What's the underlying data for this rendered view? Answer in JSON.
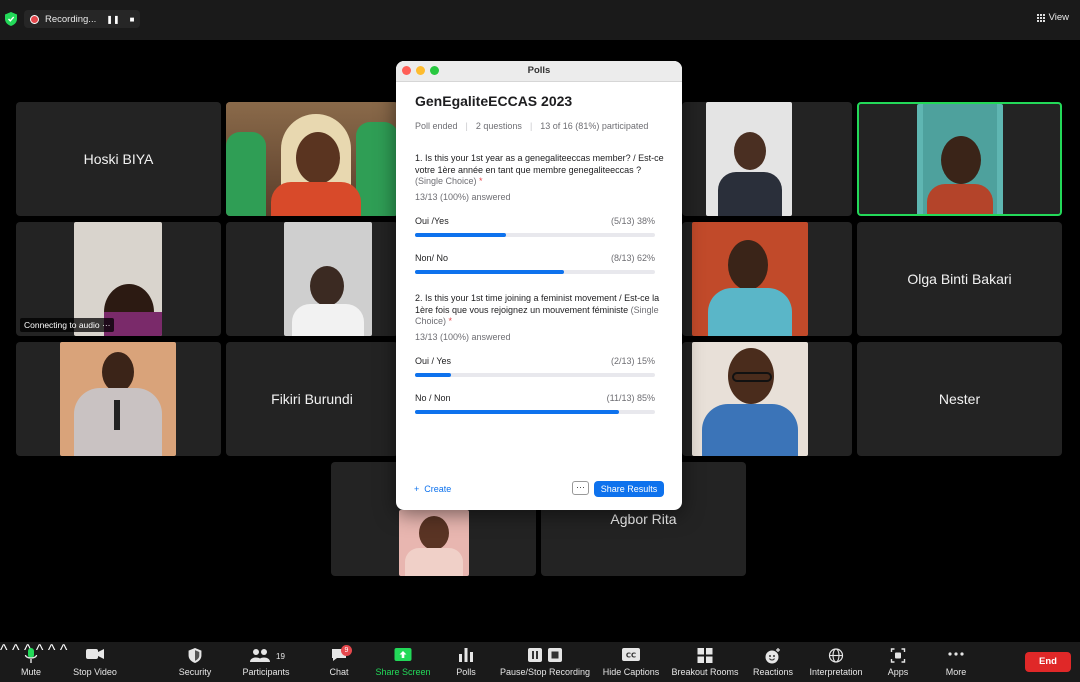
{
  "topbar": {
    "recording_label": "Recording...",
    "view_label": "View"
  },
  "tiles": {
    "hoski": "Hoski BIYA",
    "olga": "Olga Binti Bakari",
    "fikiri": "Fikiri Burundi",
    "nester": "Nester",
    "agbor": "Agbor Rita",
    "connecting": "Connecting to audio"
  },
  "polls": {
    "window_title": "Polls",
    "title": "GenEgaliteECCAS 2023",
    "status": "Poll ended",
    "questions_count": "2 questions",
    "participation": "13 of 16 (81%) participated",
    "questions": [
      {
        "text": "1. Is this your 1st year as a genegaliteeccas member? / Est-ce votre 1ère année en tant que membre genegaliteeccas ?",
        "hint": "(Single Choice)",
        "required": "*",
        "answered": "13/13 (100%) answered",
        "options": [
          {
            "label": "Oui /Yes",
            "result": "(5/13) 38%",
            "fraction": 0.38
          },
          {
            "label": "Non/ No",
            "result": "(8/13) 62%",
            "fraction": 0.62
          }
        ]
      },
      {
        "text": "2. Is this your 1st time joining a feminist movement / Est-ce la 1ère fois que vous rejoignez un mouvement féministe",
        "hint": "(Single Choice)",
        "required": "*",
        "answered": "13/13 (100%) answered",
        "options": [
          {
            "label": "Oui / Yes",
            "result": "(2/13) 15%",
            "fraction": 0.15
          },
          {
            "label": "No / Non",
            "result": "(11/13) 85%",
            "fraction": 0.85
          }
        ]
      }
    ],
    "create_label": "Create",
    "more_label": "···",
    "share_label": "Share Results"
  },
  "toolbar": {
    "mute": "Mute",
    "stop_video": "Stop Video",
    "security": "Security",
    "participants": "Participants",
    "participants_count": "19",
    "chat": "Chat",
    "chat_badge": "9",
    "share_screen": "Share Screen",
    "polls": "Polls",
    "recording": "Pause/Stop Recording",
    "captions": "Hide Captions",
    "breakout": "Breakout Rooms",
    "reactions": "Reactions",
    "interpretation": "Interpretation",
    "apps": "Apps",
    "more": "More",
    "end": "End"
  },
  "colors": {
    "accent": "#0e72ed",
    "active_speaker": "#23d959",
    "end": "#e02828",
    "share_green": "#23d959"
  }
}
